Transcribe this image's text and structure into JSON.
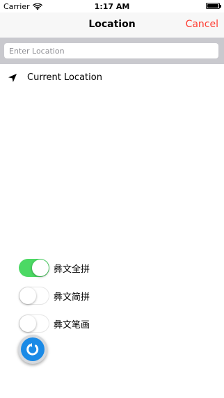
{
  "status_bar": {
    "carrier": "Carrier",
    "time": "1:17 AM"
  },
  "nav": {
    "title": "Location",
    "cancel_label": "Cancel"
  },
  "search": {
    "placeholder": "Enter Location",
    "value": ""
  },
  "current_location": {
    "label": "Current Location"
  },
  "toggles": [
    {
      "label": "彝文全拼",
      "on": true
    },
    {
      "label": "彝文简拼",
      "on": false
    },
    {
      "label": "彝文笔画",
      "on": false
    }
  ],
  "colors": {
    "accent_red": "#ff3b30",
    "switch_on": "#4cd964",
    "refresh_blue": "#1a8ae6"
  },
  "icons": {
    "wifi": "wifi-icon",
    "battery": "battery-icon",
    "location": "location-arrow-icon",
    "refresh": "refresh-icon"
  }
}
